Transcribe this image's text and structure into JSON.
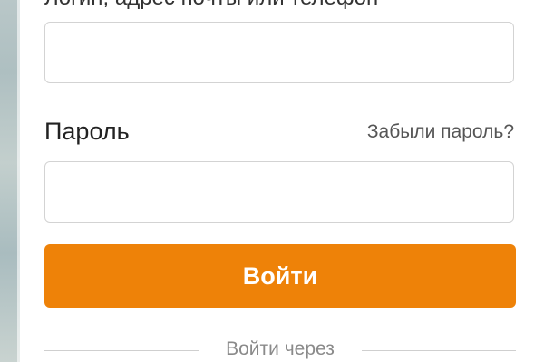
{
  "login": {
    "label": "Логин, адрес почты или телефон",
    "value": ""
  },
  "password": {
    "label": "Пароль",
    "forgot_link": "Забыли пароль?",
    "value": ""
  },
  "submit": {
    "label": "Войти"
  },
  "social": {
    "divider_label": "Войти через"
  },
  "colors": {
    "accent": "#ee8208",
    "text": "#333333",
    "muted": "#8a8a8a",
    "border": "#d3d3d3"
  }
}
